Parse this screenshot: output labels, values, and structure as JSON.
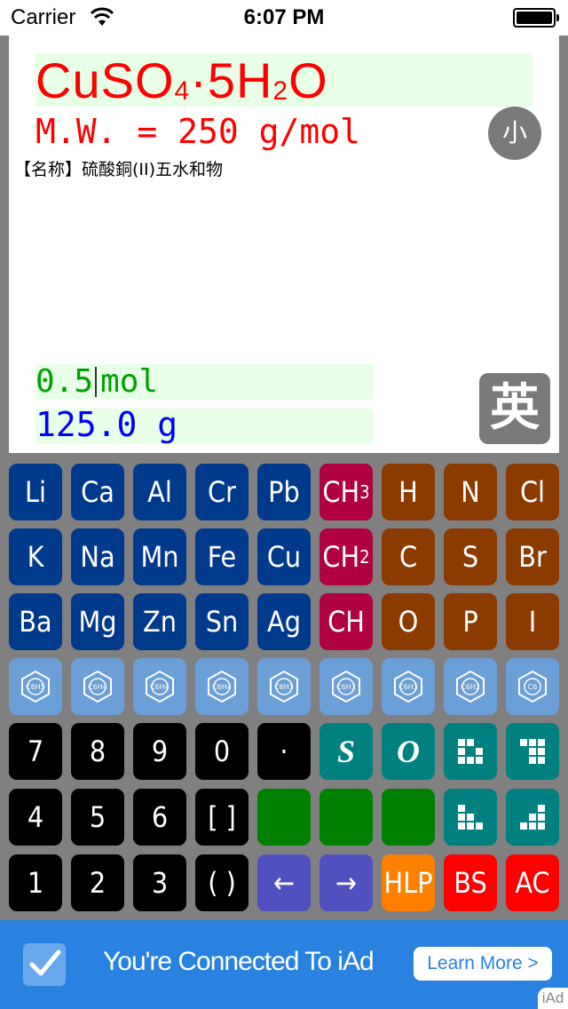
{
  "status_bar": {
    "carrier": "Carrier",
    "time": "6:07 PM"
  },
  "display": {
    "formula": {
      "a": "CuSO",
      "b": "4",
      "c": "·5H",
      "d": "2",
      "e": "O"
    },
    "mw": "M.W. = 250 g/mol",
    "name": "【名称】硫酸銅(II)五水和物",
    "size_button": "小",
    "mol_value": "0.5",
    "mol_unit": "mol",
    "gram": "125.0 g",
    "lang_button": "英"
  },
  "keypad": {
    "rows": [
      [
        {
          "t": "Li"
        },
        {
          "t": "Ca"
        },
        {
          "t": "Al"
        },
        {
          "t": "Cr"
        },
        {
          "t": "Pb"
        },
        {
          "t": "CH",
          "s": "3"
        },
        {
          "t": "H"
        },
        {
          "t": "N"
        },
        {
          "t": "Cl"
        }
      ],
      [
        {
          "t": "K"
        },
        {
          "t": "Na"
        },
        {
          "t": "Mn"
        },
        {
          "t": "Fe"
        },
        {
          "t": "Cu"
        },
        {
          "t": "CH",
          "s": "2"
        },
        {
          "t": "C"
        },
        {
          "t": "S"
        },
        {
          "t": "Br"
        }
      ],
      [
        {
          "t": "Ba"
        },
        {
          "t": "Mg"
        },
        {
          "t": "Zn"
        },
        {
          "t": "Sn"
        },
        {
          "t": "Ag"
        },
        {
          "t": "CH"
        },
        {
          "t": "O"
        },
        {
          "t": "P"
        },
        {
          "t": "I"
        }
      ],
      [
        {
          "ring": "C6H5"
        },
        {
          "ring": "C6H4"
        },
        {
          "ring": "C6H4"
        },
        {
          "ring": "C6H4"
        },
        {
          "ring": "C6H3"
        },
        {
          "ring": "C6H3"
        },
        {
          "ring": "C6H3"
        },
        {
          "ring": "C6H2"
        },
        {
          "ring": "C6"
        }
      ],
      [
        {
          "t": "7"
        },
        {
          "t": "8"
        },
        {
          "t": "9"
        },
        {
          "t": "0"
        },
        {
          "t": "·"
        },
        {
          "t": "S",
          "f": "serif"
        },
        {
          "t": "O",
          "f": "serif"
        },
        {
          "icon": "grid-icon-a"
        },
        {
          "icon": "grid-icon-b"
        }
      ],
      [
        {
          "t": "4"
        },
        {
          "t": "5"
        },
        {
          "t": "6"
        },
        {
          "t": "[ ]"
        },
        {
          "t": ""
        },
        {
          "t": ""
        },
        {
          "t": ""
        },
        {
          "icon": "grid-icon-c"
        },
        {
          "icon": "grid-icon-d"
        }
      ],
      [
        {
          "t": "1"
        },
        {
          "t": "2"
        },
        {
          "t": "3"
        },
        {
          "t": "( )"
        },
        {
          "t": "←"
        },
        {
          "t": "→"
        },
        {
          "t": "HLP"
        },
        {
          "t": "BS"
        },
        {
          "t": "AC"
        }
      ]
    ],
    "row_colors": [
      [
        "k-blue",
        "k-blue",
        "k-blue",
        "k-blue",
        "k-blue",
        "k-red",
        "k-brown",
        "k-brown",
        "k-brown"
      ],
      [
        "k-blue",
        "k-blue",
        "k-blue",
        "k-blue",
        "k-blue",
        "k-red",
        "k-brown",
        "k-brown",
        "k-brown"
      ],
      [
        "k-blue",
        "k-blue",
        "k-blue",
        "k-blue",
        "k-blue",
        "k-red",
        "k-brown",
        "k-brown",
        "k-brown"
      ],
      [
        "k-light",
        "k-light",
        "k-light",
        "k-light",
        "k-light",
        "k-light",
        "k-light",
        "k-light",
        "k-light"
      ],
      [
        "k-black",
        "k-black",
        "k-black",
        "k-black",
        "k-black",
        "k-teal",
        "k-teal",
        "k-teal",
        "k-teal"
      ],
      [
        "k-black",
        "k-black",
        "k-black",
        "k-black",
        "k-green",
        "k-green",
        "k-green",
        "k-teal",
        "k-teal"
      ],
      [
        "k-black",
        "k-black",
        "k-black",
        "k-black",
        "k-purple",
        "k-purple",
        "k-orange",
        "k-bright",
        "k-bright"
      ]
    ]
  },
  "ad": {
    "text": "You're Connected To iAd",
    "button": "Learn More >",
    "badge": "iAd"
  }
}
